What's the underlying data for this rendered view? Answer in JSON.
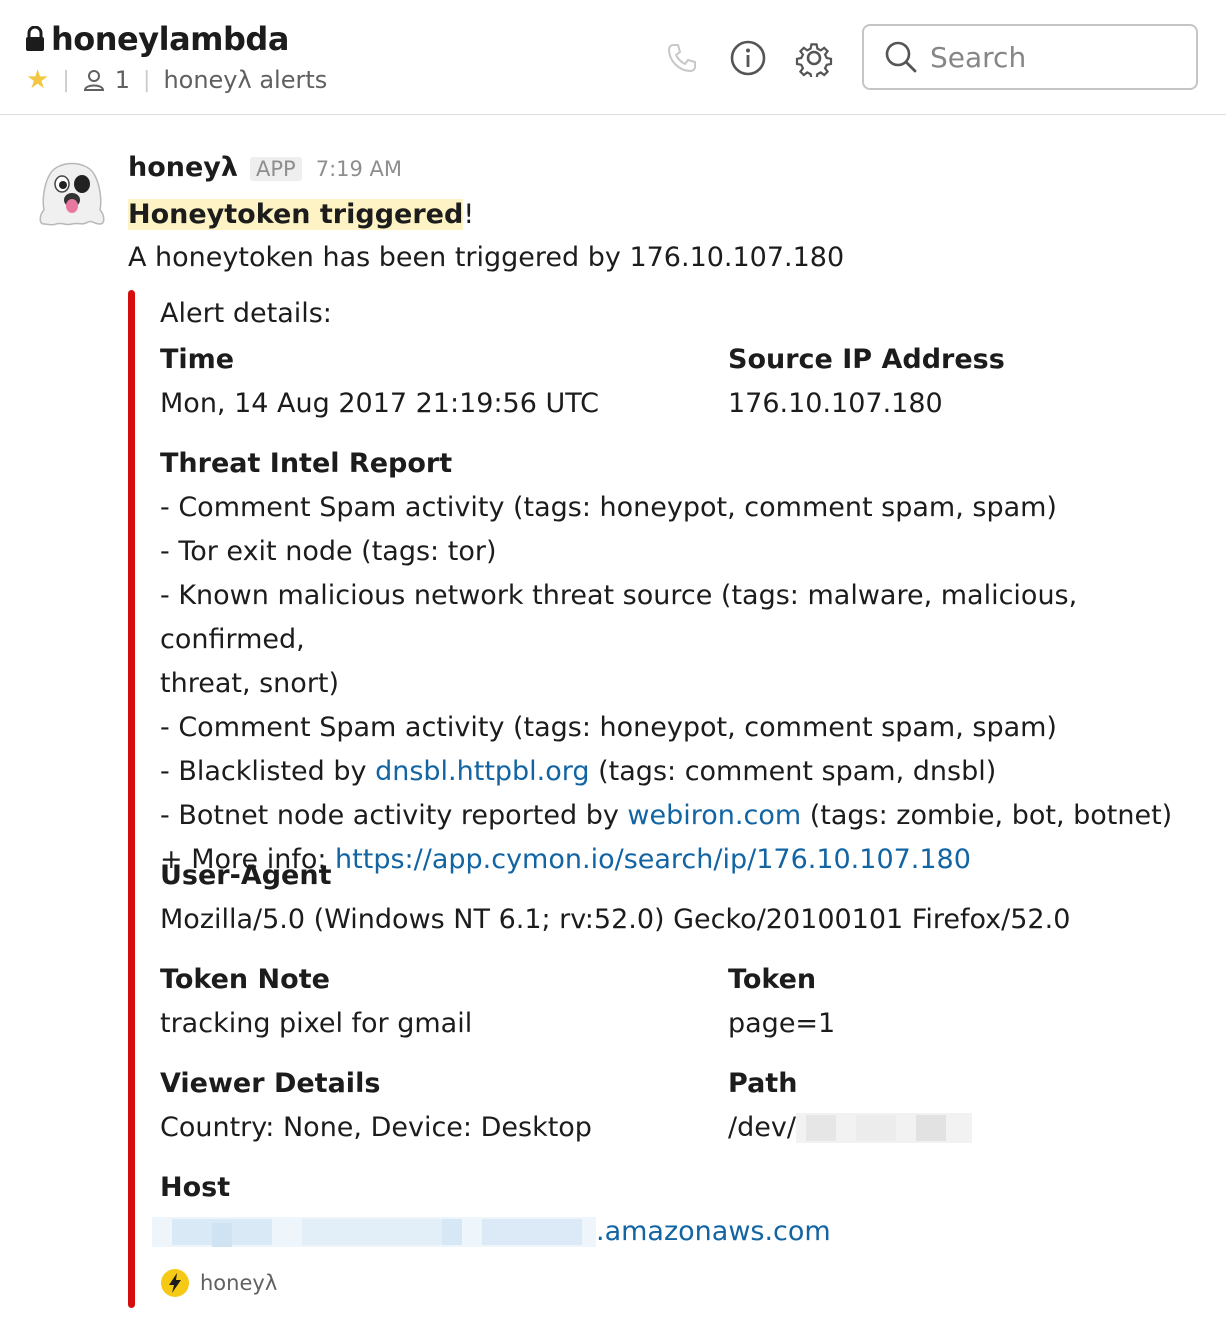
{
  "channel": {
    "name": "honeylambda",
    "member_count": "1",
    "topic": "honeyλ alerts"
  },
  "search": {
    "placeholder": "Search"
  },
  "message": {
    "sender": "honeyλ",
    "badge": "APP",
    "time": "7:19 AM",
    "headline_highlight": "Honeytoken triggered",
    "headline_tail": "!",
    "body": "A honeytoken has been triggered by 176.10.107.180"
  },
  "attachment": {
    "color": "#d40e0d",
    "pretext": "Alert details:",
    "fields": {
      "time": {
        "title": "Time",
        "value": "Mon, 14 Aug 2017 21:19:56 UTC"
      },
      "source_ip": {
        "title": "Source IP Address",
        "value": "176.10.107.180"
      },
      "threat_intel": {
        "title": "Threat Intel Report",
        "line1": "- Comment Spam activity (tags: honeypot, comment spam, spam)",
        "line2": "- Tor exit node (tags: tor)",
        "line3a": "- Known malicious network threat source (tags: malware, malicious, confirmed,",
        "line3b": "threat, snort)",
        "line4": "- Comment Spam activity (tags: honeypot, comment spam, spam)",
        "line5_pre": "- Blacklisted by ",
        "line5_link": "dnsbl.httpbl.org",
        "line5_post": " (tags: comment spam, dnsbl)",
        "line6_pre": "- Botnet node activity reported by ",
        "line6_link": "webiron.com",
        "line6_post": " (tags: zombie, bot, botnet)",
        "more_pre": "+ More info: ",
        "more_link": "https://app.cymon.io/search/ip/176.10.107.180"
      },
      "user_agent": {
        "title": "User-Agent",
        "value": "Mozilla/5.0 (Windows NT 6.1; rv:52.0) Gecko/20100101 Firefox/52.0"
      },
      "token_note": {
        "title": "Token Note",
        "value": "tracking pixel for gmail"
      },
      "token": {
        "title": "Token",
        "value": "page=1"
      },
      "viewer_details": {
        "title": "Viewer Details",
        "value": "Country: None, Device: Desktop"
      },
      "path": {
        "title": "Path",
        "value": "/dev/"
      },
      "host": {
        "title": "Host",
        "value_suffix": ".amazonaws.com"
      }
    },
    "footer": "honeyλ"
  },
  "colors": {
    "link": "#1264a3",
    "highlight": "#fdf3c5",
    "star": "#f2c744",
    "attachment_bar": "#d40e0d"
  },
  "icons": [
    "lock-icon",
    "star-icon",
    "member-icon",
    "phone-icon",
    "info-icon",
    "gear-icon",
    "search-icon",
    "ghost-avatar-icon",
    "lightning-bolt-icon"
  ]
}
